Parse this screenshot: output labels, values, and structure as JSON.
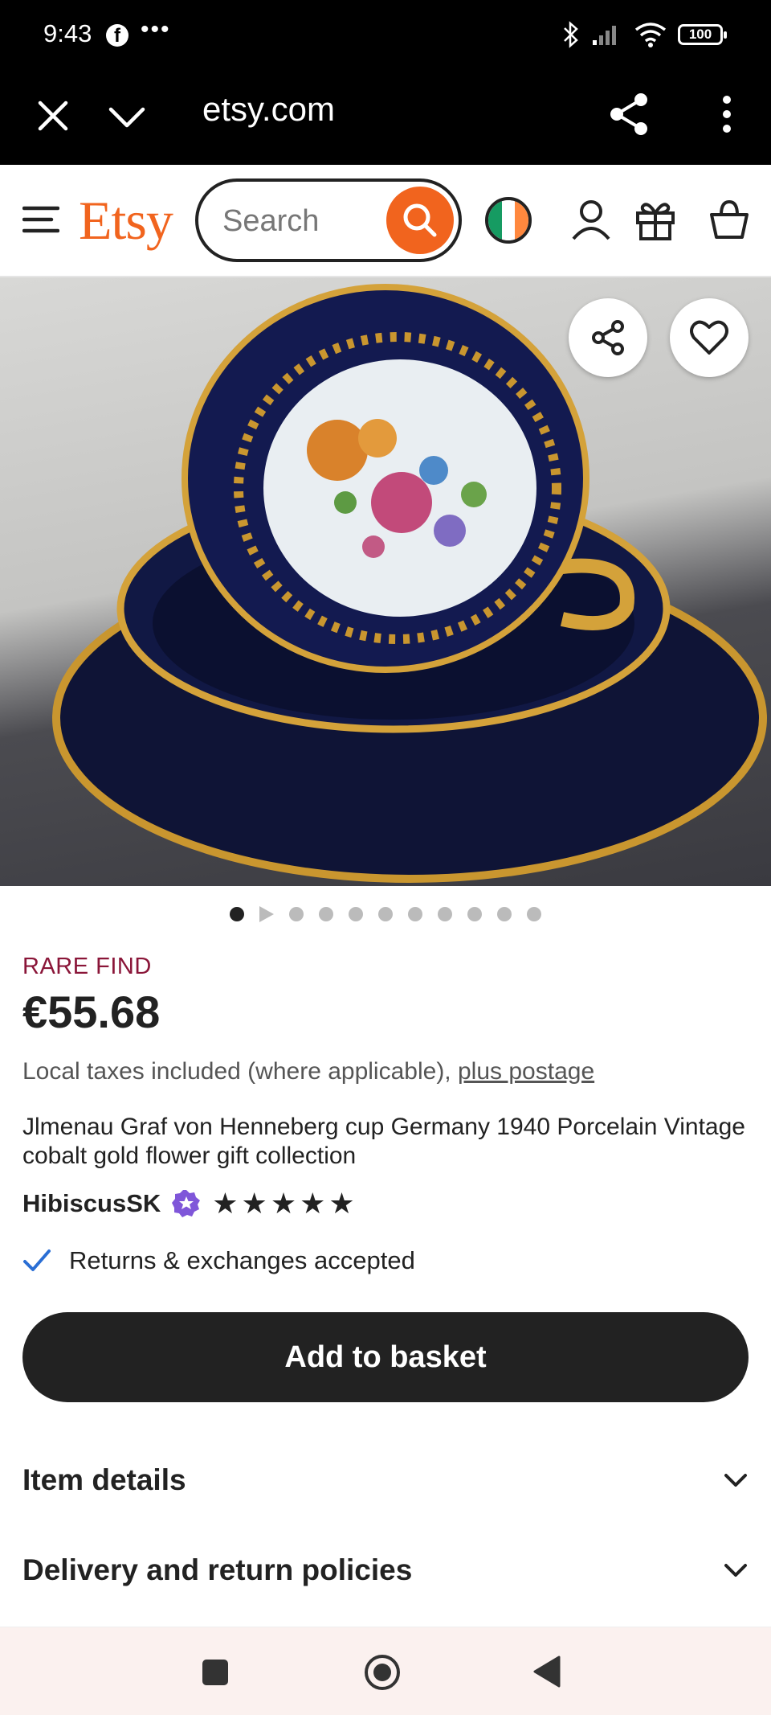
{
  "status_bar": {
    "time": "9:43",
    "fb_glyph": "f",
    "dots": "•••",
    "battery": "100"
  },
  "browser": {
    "url": "etsy.com"
  },
  "header": {
    "logo": "Etsy",
    "search_placeholder": "Search",
    "flag_colors": [
      "#169b62",
      "#ffffff",
      "#ff883e"
    ]
  },
  "gallery": {
    "dot_count": 10,
    "active_index": 0
  },
  "listing": {
    "badge": "RARE FIND",
    "price": "€55.68",
    "taxes_text": "Local taxes included (where applicable),",
    "postage_link": "plus postage",
    "title": "Jlmenau Graf von Henneberg cup Germany 1940 Porcelain Vintage cobalt gold flower gift collection",
    "seller": "HibiscusSK",
    "rating": 5,
    "stars": "★★★★★",
    "returns": "Returns & exchanges accepted",
    "cta": "Add to basket"
  },
  "sections": [
    {
      "label": "Item details"
    },
    {
      "label": "Delivery and return policies"
    }
  ],
  "colors": {
    "etsy_orange": "#f1641e",
    "rare_find": "#8a1538",
    "star_seller": "#7f56d9",
    "check": "#2a6ed4"
  }
}
